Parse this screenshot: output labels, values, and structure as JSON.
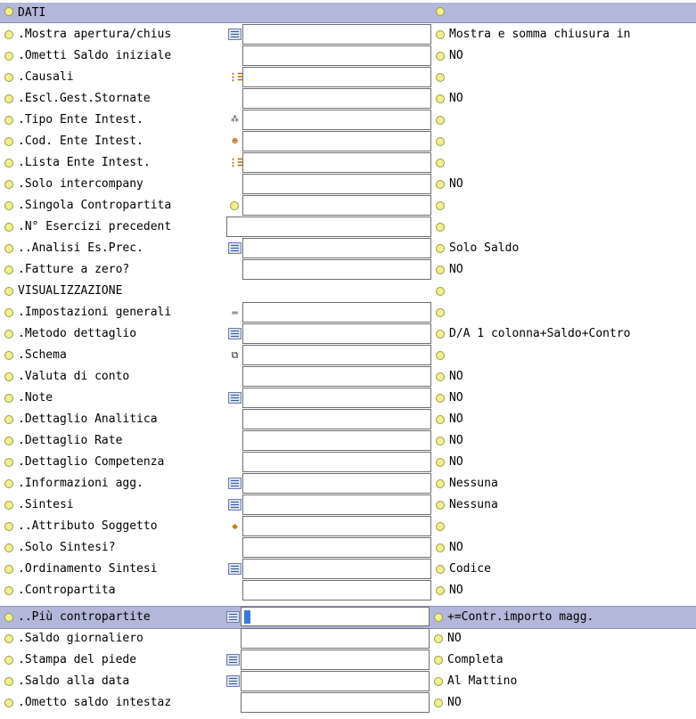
{
  "header": {
    "label": "DATI"
  },
  "rows": [
    {
      "label": ".Mostra apertura/chius",
      "icon": "listbox-icon",
      "value": "Mostra e somma chiusura in"
    },
    {
      "label": ".Ometti Saldo iniziale",
      "icon": "",
      "value": "NO"
    },
    {
      "label": ".Causali",
      "icon": "list-icon",
      "value": ""
    },
    {
      "label": ".Escl.Gest.Stornate",
      "icon": "",
      "value": "NO"
    },
    {
      "label": ".Tipo Ente Intest.",
      "icon": "network-icon",
      "value": ""
    },
    {
      "label": ".Cod. Ente Intest.",
      "icon": "person-icon",
      "value": ""
    },
    {
      "label": ".Lista Ente Intest.",
      "icon": "list-icon",
      "value": ""
    },
    {
      "label": ".Solo intercompany",
      "icon": "",
      "value": "NO"
    },
    {
      "label": ".Singola Contropartita",
      "icon": "dot-icon",
      "value": ""
    },
    {
      "label": ".N° Esercizi precedent",
      "icon": "",
      "value": ""
    },
    {
      "label": "..Analisi Es.Prec.",
      "icon": "listbox-icon",
      "value": "Solo Saldo"
    },
    {
      "label": ".Fatture a zero?",
      "icon": "",
      "value": "NO"
    },
    {
      "label": "VISUALIZZAZIONE",
      "icon": "",
      "value": "",
      "section": true
    },
    {
      "label": ".Impostazioni generali",
      "icon": "folder-icon",
      "value": ""
    },
    {
      "label": ".Metodo dettaglio",
      "icon": "listbox-icon",
      "value": "D/A 1 colonna+Saldo+Contro"
    },
    {
      "label": ".Schema",
      "icon": "copy-icon",
      "value": ""
    },
    {
      "label": ".Valuta di conto",
      "icon": "",
      "value": "NO"
    },
    {
      "label": ".Note",
      "icon": "listbox-icon",
      "value": "NO"
    },
    {
      "label": ".Dettaglio Analitica",
      "icon": "",
      "value": "NO"
    },
    {
      "label": ".Dettaglio Rate",
      "icon": "",
      "value": "NO"
    },
    {
      "label": ".Dettaglio Competenza",
      "icon": "",
      "value": "NO"
    },
    {
      "label": ".Informazioni agg.",
      "icon": "listbox-icon",
      "value": "Nessuna"
    },
    {
      "label": ".Sintesi",
      "icon": "listbox-icon",
      "value": "Nessuna"
    },
    {
      "label": "..Attributo Soggetto",
      "icon": "tag-icon",
      "value": ""
    },
    {
      "label": ".Solo Sintesi?",
      "icon": "",
      "value": "NO"
    },
    {
      "label": ".Ordinamento Sintesi",
      "icon": "listbox-icon",
      "value": "Codice"
    },
    {
      "label": ".Contropartita",
      "icon": "",
      "value": "NO"
    },
    {
      "label": "..Più contropartite",
      "icon": "listbox-icon",
      "value": "+=Contr.importo magg.",
      "selected": true
    },
    {
      "label": ".Saldo giornaliero",
      "icon": "",
      "value": "NO"
    },
    {
      "label": ".Stampa del piede",
      "icon": "listbox-icon",
      "value": "Completa"
    },
    {
      "label": ".Saldo alla data",
      "icon": "listbox-icon",
      "value": "Al Mattino"
    },
    {
      "label": ".Ometto saldo intestaz",
      "icon": "",
      "value": "NO"
    }
  ]
}
